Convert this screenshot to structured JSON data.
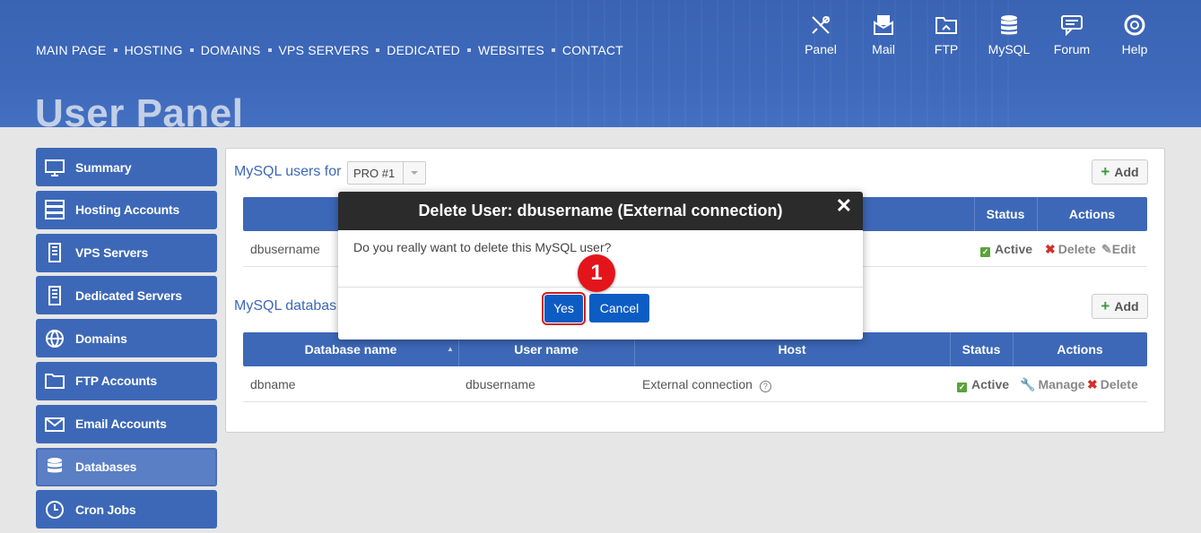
{
  "nav": {
    "links": [
      "MAIN PAGE",
      "HOSTING",
      "DOMAINS",
      "VPS SERVERS",
      "DEDICATED",
      "WEBSITES",
      "CONTACT"
    ]
  },
  "icons": [
    {
      "label": "Panel",
      "icon": "tools-icon"
    },
    {
      "label": "Mail",
      "icon": "mail-icon"
    },
    {
      "label": "FTP",
      "icon": "folder-icon"
    },
    {
      "label": "MySQL",
      "icon": "database-icon"
    },
    {
      "label": "Forum",
      "icon": "chat-icon"
    },
    {
      "label": "Help",
      "icon": "lifebuoy-icon"
    }
  ],
  "page_title": "User Panel",
  "sidebar": {
    "items": [
      {
        "label": "Summary",
        "icon": "monitor-icon"
      },
      {
        "label": "Hosting Accounts",
        "icon": "server-icon"
      },
      {
        "label": "VPS Servers",
        "icon": "tower-icon"
      },
      {
        "label": "Dedicated Servers",
        "icon": "tower-icon"
      },
      {
        "label": "Domains",
        "icon": "globe-icon"
      },
      {
        "label": "FTP Accounts",
        "icon": "folder-icon"
      },
      {
        "label": "Email Accounts",
        "icon": "envelope-icon"
      },
      {
        "label": "Databases",
        "icon": "database-icon"
      },
      {
        "label": "Cron Jobs",
        "icon": "clock-icon"
      }
    ],
    "active": "Databases"
  },
  "users_section": {
    "title": "MySQL users for",
    "select_value": "PRO #1",
    "add_label": "Add",
    "headers": {
      "status": "Status",
      "actions": "Actions"
    },
    "row": {
      "user": "dbusername",
      "status": "Active",
      "delete": "Delete",
      "edit": "Edit"
    }
  },
  "db_section": {
    "title": "MySQL databas",
    "add_label": "Add",
    "headers": {
      "db": "Database name",
      "user": "User name",
      "host": "Host",
      "status": "Status",
      "actions": "Actions"
    },
    "row": {
      "db": "dbname",
      "user": "dbusername",
      "host": "External connection",
      "status": "Active",
      "manage": "Manage",
      "delete": "Delete"
    }
  },
  "dialog": {
    "title": "Delete User: dbusername (External connection)",
    "close": "✕",
    "message": "Do you really want to delete this MySQL user?",
    "yes": "Yes",
    "cancel": "Cancel"
  },
  "callout": "1",
  "colors": {
    "primary": "#3d68b8",
    "dialog_header": "#2b2b2b",
    "button": "#0d5cc4",
    "callout": "#e4141b"
  }
}
